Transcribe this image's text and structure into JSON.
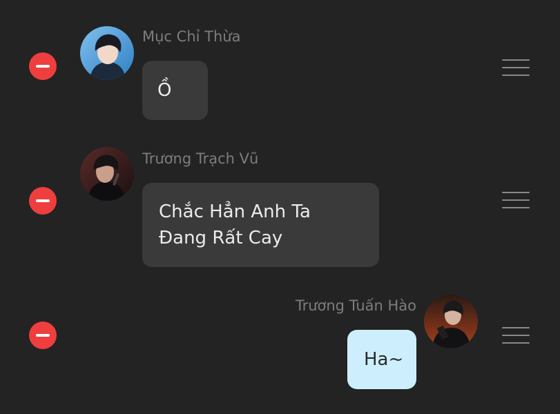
{
  "messages": [
    {
      "sender": "Mục Chỉ Thừa",
      "text": "Ồ",
      "direction": "incoming",
      "avatar": "user-avatar-photo"
    },
    {
      "sender": "Trương Trạch Vũ",
      "text": "Chắc Hẳn Anh Ta Đang Rất Cay",
      "direction": "incoming",
      "avatar": "user-avatar-photo"
    },
    {
      "sender": "Trương Tuấn Hào",
      "text": "Ha~",
      "direction": "outgoing",
      "avatar": "user-avatar-photo"
    }
  ],
  "icons": {
    "delete": "minus-circle-icon",
    "reorder": "drag-handle-icon"
  },
  "colors": {
    "background": "#232323",
    "delete": "#ef3e3e",
    "incoming_bubble": "#3a3a3a",
    "outgoing_bubble": "#cdeffd",
    "sender_text": "#7d7d7d"
  }
}
